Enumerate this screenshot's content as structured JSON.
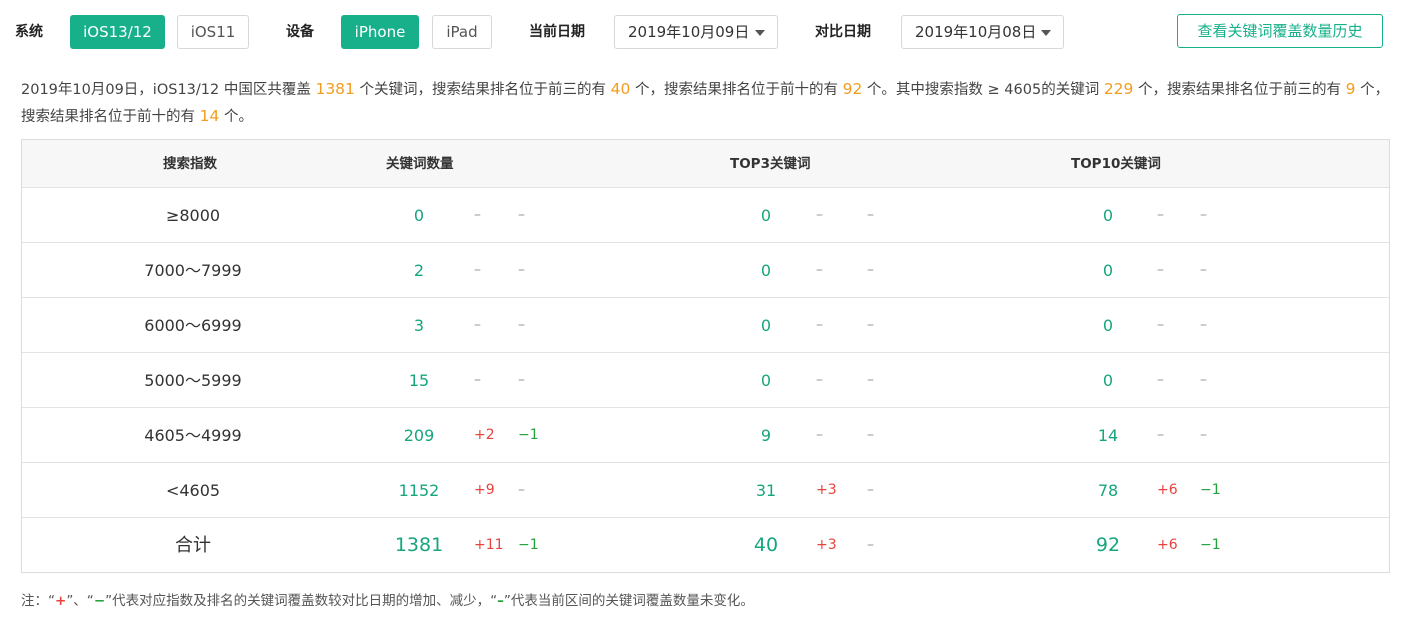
{
  "filters": {
    "system_label": "系统",
    "system_options": [
      "iOS13/12",
      "iOS11"
    ],
    "system_selected": "iOS13/12",
    "device_label": "设备",
    "device_options": [
      "iPhone",
      "iPad"
    ],
    "device_selected": "iPhone",
    "current_date_label": "当前日期",
    "current_date_value": "2019年10月09日",
    "compare_date_label": "对比日期",
    "compare_date_value": "2019年10月08日",
    "history_button": "查看关键词覆盖数量历史"
  },
  "summary": [
    {
      "t": "2019年10月09日，iOS13/12 中国区共覆盖 "
    },
    {
      "t": "1381",
      "hl": true
    },
    {
      "t": " 个关键词，搜索结果排名位于前三的有 "
    },
    {
      "t": "40",
      "hl": true
    },
    {
      "t": " 个，搜索结果排名位于前十的有 "
    },
    {
      "t": "92",
      "hl": true
    },
    {
      "t": " 个。其中搜索指数 ≥ 4605的关键词 "
    },
    {
      "t": "229",
      "hl": true
    },
    {
      "t": " 个，搜索结果排名位于前三的有 "
    },
    {
      "t": "9",
      "hl": true
    },
    {
      "t": " 个，搜索结果排名位于前十的有 "
    },
    {
      "t": "14",
      "hl": true
    },
    {
      "t": " 个。"
    }
  ],
  "table": {
    "headers": [
      "搜索指数",
      "关键词数量",
      "TOP3关键词",
      "TOP10关键词"
    ],
    "rows": [
      {
        "range": "≥8000",
        "kw": [
          "0",
          "–",
          "–"
        ],
        "top3": [
          "0",
          "–",
          "–"
        ],
        "top10": [
          "0",
          "–",
          "–"
        ]
      },
      {
        "range": "7000～7999",
        "kw": [
          "2",
          "–",
          "–"
        ],
        "top3": [
          "0",
          "–",
          "–"
        ],
        "top10": [
          "0",
          "–",
          "–"
        ]
      },
      {
        "range": "6000～6999",
        "kw": [
          "3",
          "–",
          "–"
        ],
        "top3": [
          "0",
          "–",
          "–"
        ],
        "top10": [
          "0",
          "–",
          "–"
        ]
      },
      {
        "range": "5000～5999",
        "kw": [
          "15",
          "–",
          "–"
        ],
        "top3": [
          "0",
          "–",
          "–"
        ],
        "top10": [
          "0",
          "–",
          "–"
        ]
      },
      {
        "range": "4605～4999",
        "kw": [
          "209",
          "+2",
          "−1"
        ],
        "top3": [
          "9",
          "–",
          "–"
        ],
        "top10": [
          "14",
          "–",
          "–"
        ]
      },
      {
        "range": "<4605",
        "kw": [
          "1152",
          "+9",
          "–"
        ],
        "top3": [
          "31",
          "+3",
          "–"
        ],
        "top10": [
          "78",
          "+6",
          "−1"
        ]
      },
      {
        "range": "合计",
        "kw": [
          "1381",
          "+11",
          "−1"
        ],
        "top3": [
          "40",
          "+3",
          "–"
        ],
        "top10": [
          "92",
          "+6",
          "−1"
        ]
      }
    ]
  },
  "note": {
    "prefix": "注：“",
    "plus": "+",
    "sep": "”、“",
    "minus": "−",
    "mid": "”代表对应指数及排名的关键词覆盖数较对比日期的增加、减少，“",
    "dash": "–",
    "suffix": "”代表当前区间的关键词覆盖数量未变化。"
  },
  "colors": {
    "accent": "#17b08a",
    "highlight": "#f39c1f",
    "increase": "#e8423c",
    "decrease": "#22a23b"
  }
}
